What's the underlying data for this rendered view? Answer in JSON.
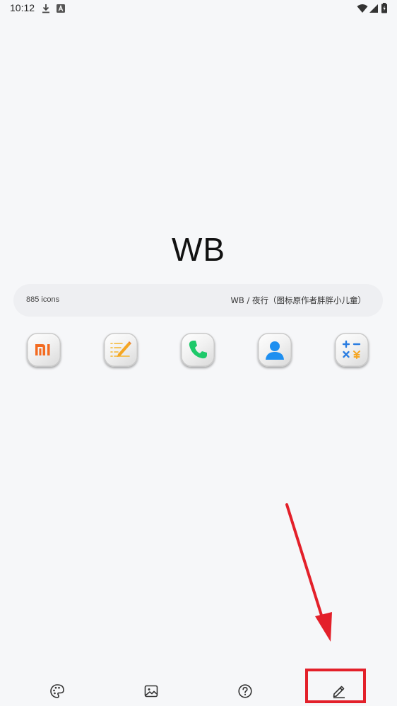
{
  "status_bar": {
    "time": "10:12",
    "left_icons": [
      "download-icon",
      "a-notification-icon"
    ],
    "right_icons": [
      "wifi-icon",
      "signal-icon",
      "battery-icon"
    ]
  },
  "title": "WB",
  "info_bar": {
    "icon_count": "885 icons",
    "author": "WB / 夜行（图标原作者胖胖小儿童）"
  },
  "preview_icons": [
    {
      "name": "mi-app-icon",
      "color": "#f36b21"
    },
    {
      "name": "notes-app-icon",
      "color": "#f5b52e"
    },
    {
      "name": "phone-app-icon",
      "color": "#1ec96a"
    },
    {
      "name": "contacts-app-icon",
      "color": "#1e8ff0"
    },
    {
      "name": "calculator-app-icon",
      "color": "#2a7de1"
    }
  ],
  "bottom_nav": [
    {
      "name": "palette-icon"
    },
    {
      "name": "wallpaper-icon"
    },
    {
      "name": "help-icon"
    },
    {
      "name": "edit-icon"
    }
  ],
  "annotation": {
    "highlight_color": "#e3202a"
  }
}
